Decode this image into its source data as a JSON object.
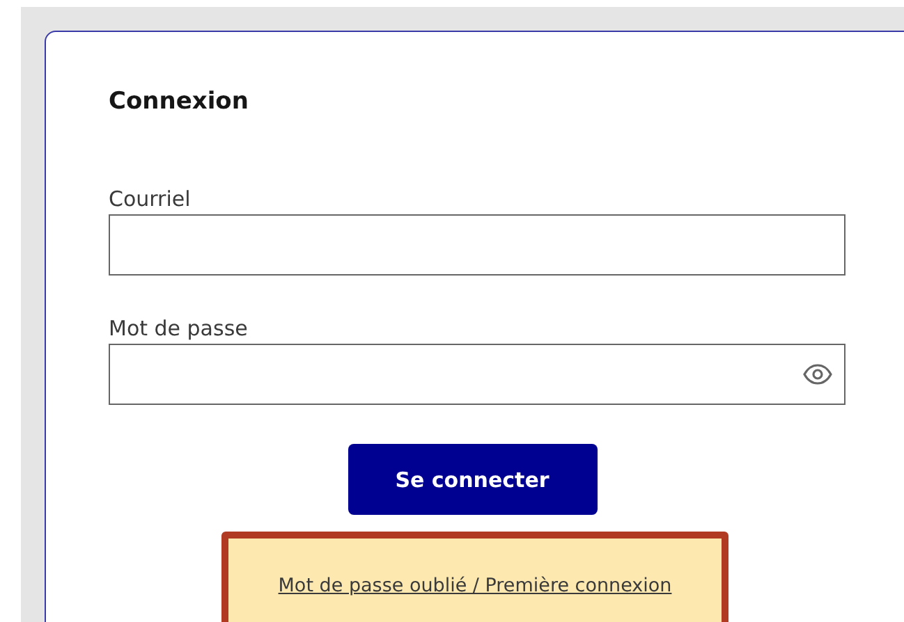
{
  "title": "Connexion",
  "fields": [
    {
      "kind": "text",
      "label": "Courriel"
    },
    {
      "kind": "password",
      "label": "Mot de passe"
    }
  ],
  "submit": "Se connecter",
  "link": {
    "text": "Mot de passe oublié / Première connexion",
    "highlighted": true
  }
}
